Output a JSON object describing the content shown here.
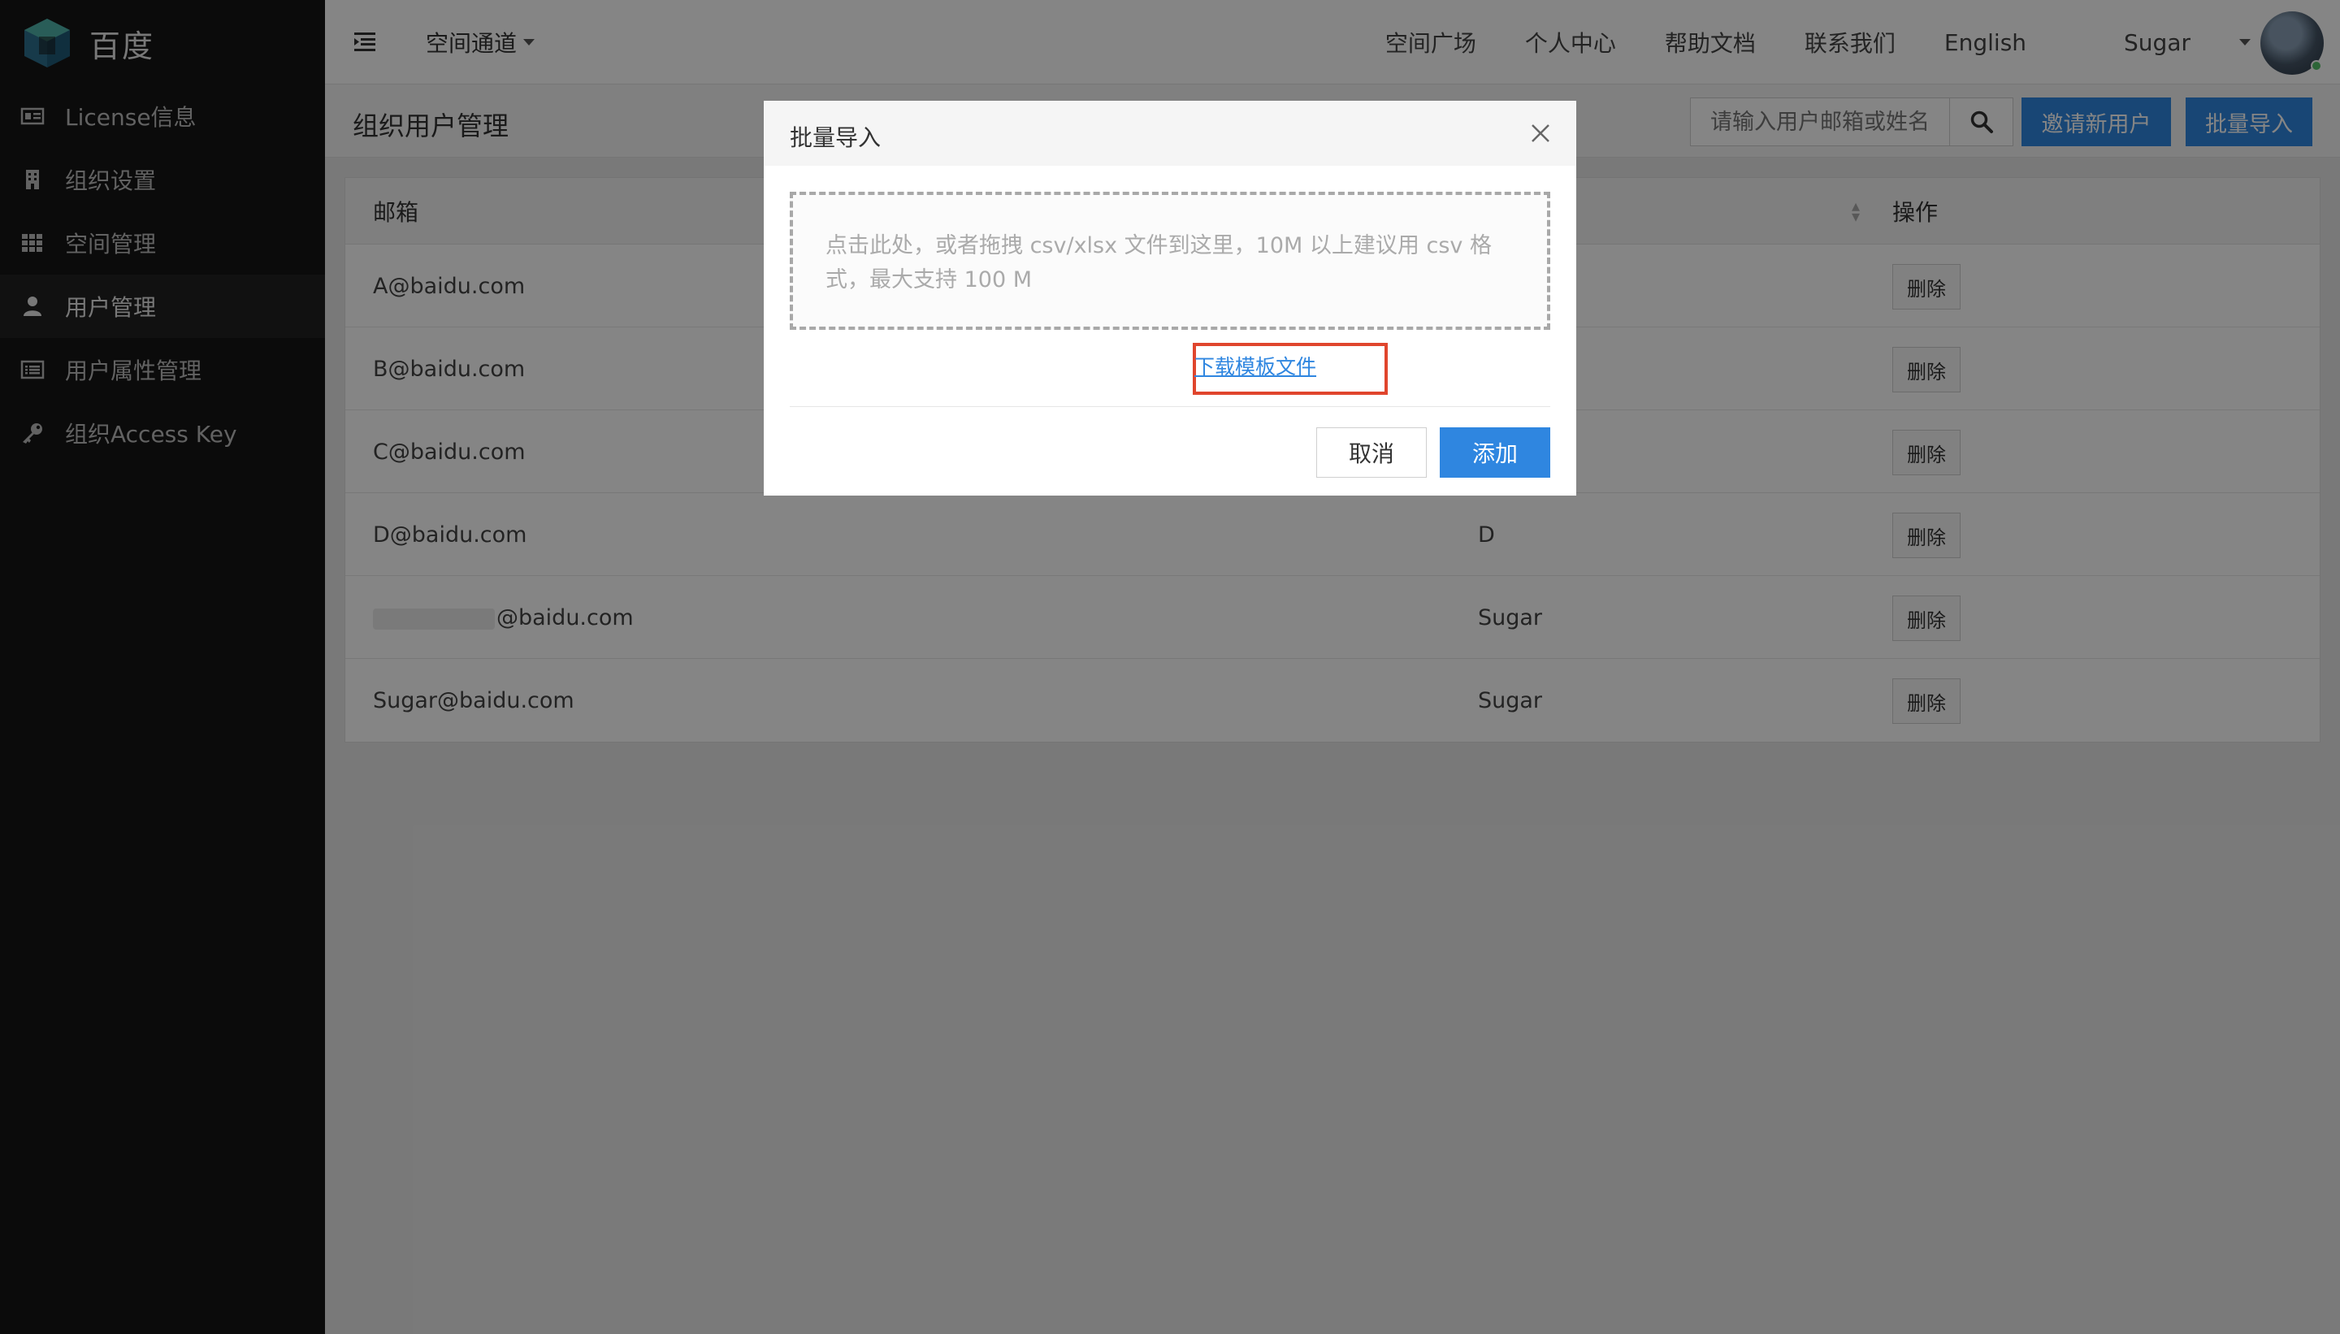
{
  "app": {
    "brand": "百度"
  },
  "sidebar": {
    "items": [
      {
        "label": "License信息",
        "icon": "id-card-icon"
      },
      {
        "label": "组织设置",
        "icon": "building-icon"
      },
      {
        "label": "空间管理",
        "icon": "grid-icon"
      },
      {
        "label": "用户管理",
        "icon": "user-icon",
        "active": true
      },
      {
        "label": "用户属性管理",
        "icon": "list-icon"
      },
      {
        "label": "组织Access Key",
        "icon": "key-icon"
      }
    ]
  },
  "topbar": {
    "space_channel": "空间通道",
    "nav": [
      "空间广场",
      "个人中心",
      "帮助文档",
      "联系我们",
      "English"
    ],
    "user": "Sugar"
  },
  "page": {
    "title": "组织用户管理",
    "search_placeholder": "请输入用户邮箱或姓名",
    "invite_label": "邀请新用户",
    "bulk_import_label": "批量导入"
  },
  "table": {
    "columns": {
      "email": "邮箱",
      "name": "",
      "op": "操作"
    },
    "rows": [
      {
        "email": "A@baidu.com",
        "name": "",
        "action": "删除"
      },
      {
        "email": "B@baidu.com",
        "name": "",
        "action": "删除"
      },
      {
        "email": "C@baidu.com",
        "name": "",
        "action": "删除"
      },
      {
        "email": "D@baidu.com",
        "name": "D",
        "action": "删除"
      },
      {
        "email": "@baidu.com",
        "name": "Sugar",
        "action": "删除"
      },
      {
        "email": "Sugar@baidu.com",
        "name": "Sugar",
        "action": "删除"
      }
    ]
  },
  "modal": {
    "title": "批量导入",
    "dropzone_text": "点击此处，或者拖拽 csv/xlsx 文件到这里，10M 以上建议用 csv 格式，最大支持 100 M",
    "download_link": "下载模板文件",
    "cancel_label": "取消",
    "add_label": "添加"
  },
  "colors": {
    "sidebar_bg": "#161616",
    "primary": "#2f86e0",
    "highlight": "#e0452d"
  }
}
